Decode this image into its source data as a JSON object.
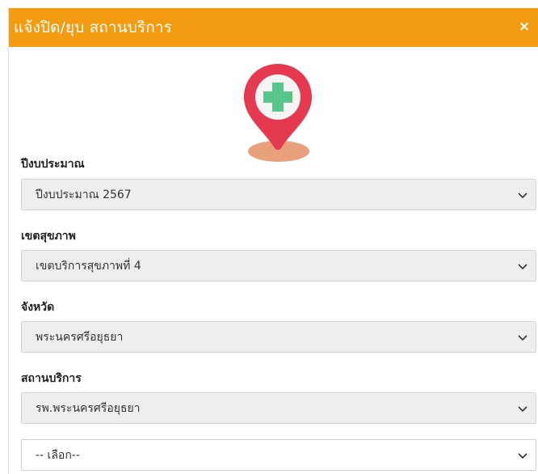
{
  "modal": {
    "title": "แจ้งปิด/ยุบ สถานบริการ",
    "close_label": "×",
    "header_color": "#f39c12"
  },
  "hero": {
    "icon": "hospital-location-pin-icon"
  },
  "form": {
    "fields": [
      {
        "label": "ปีงบประมาณ",
        "value": "ปีงบประมาณ 2567",
        "disabled": true
      },
      {
        "label": "เขตสุขภาพ",
        "value": "เขตบริการสุขภาพที่ 4",
        "disabled": true
      },
      {
        "label": "จังหวัด",
        "value": "พระนครศรีอยุธยา",
        "disabled": true
      },
      {
        "label": "สถานบริการ",
        "value": "รพ.พระนครศรีอยุธยา",
        "disabled": true
      }
    ],
    "extra_select": {
      "value": "-- เลือก--",
      "disabled": false
    }
  }
}
